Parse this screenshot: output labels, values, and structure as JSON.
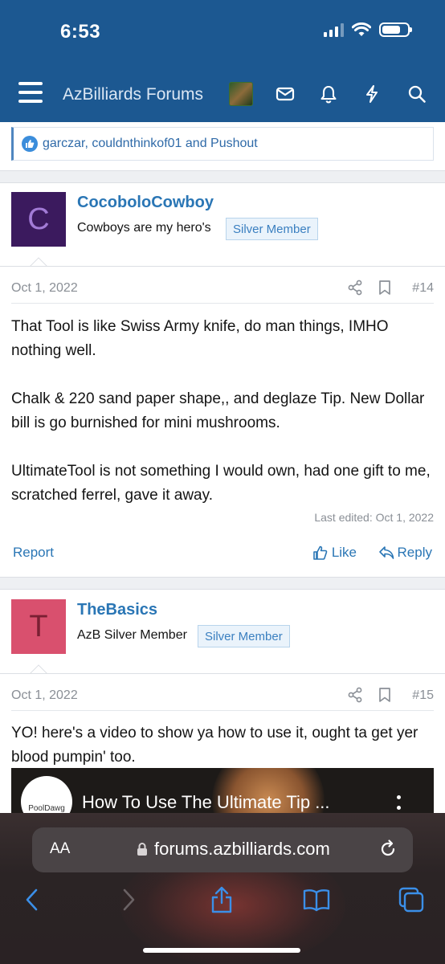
{
  "status_bar": {
    "time": "6:53"
  },
  "nav": {
    "brand": "AzBilliards Forums",
    "icons": [
      "menu-icon",
      "user-avatar",
      "mail-icon",
      "bell-icon",
      "bolt-icon",
      "search-icon"
    ]
  },
  "reactions": {
    "names": "garczar, couldnthinkof01 and Pushout"
  },
  "posts": [
    {
      "avatar_letter": "C",
      "avatar_color": "#3b1a5e",
      "avatar_text_color": "#a27bd6",
      "username": "CocoboloCowboy",
      "user_title": "Cowboys are my hero's",
      "badge": "Silver Member",
      "date": "Oct 1, 2022",
      "number": "#14",
      "body": [
        "That Tool is like Swiss Army knife, do man things, IMHO nothing well.",
        "Chalk & 220 sand paper shape,, and deglaze Tip. New Dollar bill is go burnished for mini mushrooms.",
        "UltimateTool is not something I would own, had one gift to me, scratched ferrel, gave it away."
      ],
      "last_edited": "Last edited: Oct 1, 2022",
      "actions": {
        "report": "Report",
        "like": "Like",
        "reply": "Reply"
      }
    },
    {
      "avatar_letter": "T",
      "avatar_color": "#d9506e",
      "avatar_text_color": "#7a1f33",
      "username": "TheBasics",
      "user_title": "AzB Silver Member",
      "badge": "Silver Member",
      "date": "Oct 1, 2022",
      "number": "#15",
      "body": [
        "YO! here's a video to show ya how to use it, ought ta get yer blood pumpin' too."
      ],
      "video": {
        "title": "How To Use The Ultimate Tip ...",
        "channel_logo_text": "PoolDawg"
      }
    }
  ],
  "safari": {
    "text_size_label": "AA",
    "url": "forums.azbilliards.com",
    "toolbar": [
      "back-icon",
      "forward-icon",
      "share-icon",
      "bookmarks-icon",
      "tabs-icon"
    ]
  },
  "colors": {
    "header": "#1c5891",
    "link": "#2a76b5",
    "badge_bg": "#eaf3fb"
  }
}
